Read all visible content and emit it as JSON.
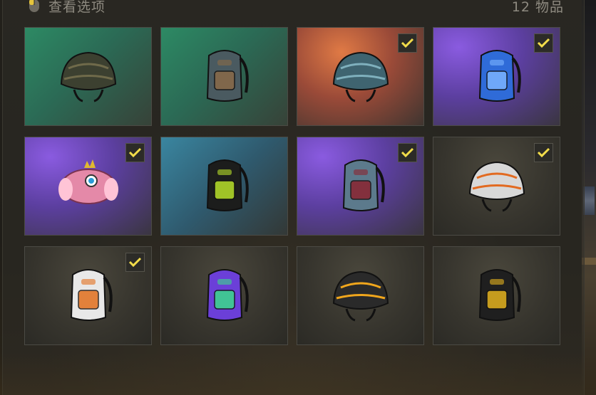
{
  "header": {
    "title": "查看选项",
    "count": "12 物品"
  },
  "colors": {
    "check": "#f2dc4a",
    "tile_green": "#2f7b5f",
    "tile_orange": "#c06a3c",
    "tile_purple": "#6a48b0",
    "tile_blue": "#3b6f8a",
    "tile_neutral": "#3b3a33"
  },
  "items": [
    {
      "name": "helmet-net",
      "icon": "helmet-icon",
      "rarity": "green",
      "checked": false
    },
    {
      "name": "backpack-rusty",
      "icon": "backpack-icon",
      "rarity": "green",
      "checked": false
    },
    {
      "name": "helmet-level3-cracked",
      "icon": "helmet-icon",
      "rarity": "orange",
      "checked": true
    },
    {
      "name": "backpack-blue-camo",
      "icon": "backpack-icon",
      "rarity": "purple",
      "checked": true
    },
    {
      "name": "bunny-hat-pink",
      "icon": "hat-icon",
      "rarity": "purple",
      "checked": true
    },
    {
      "name": "backpack-black-lime",
      "icon": "backpack-icon",
      "rarity": "blue",
      "checked": false
    },
    {
      "name": "backpack-shark",
      "icon": "backpack-icon",
      "rarity": "purple",
      "checked": true
    },
    {
      "name": "helmet-white-visor",
      "icon": "helmet-icon",
      "rarity": "neutral",
      "checked": true
    },
    {
      "name": "backpack-white-orange",
      "icon": "backpack-icon",
      "rarity": "neutral",
      "checked": true
    },
    {
      "name": "backpack-purple-green",
      "icon": "backpack-icon",
      "rarity": "neutral",
      "checked": false
    },
    {
      "name": "helmet-black-yellow",
      "icon": "helmet-icon",
      "rarity": "neutral",
      "checked": false
    },
    {
      "name": "backpack-black-yellow",
      "icon": "backpack-icon",
      "rarity": "neutral",
      "checked": false
    }
  ]
}
